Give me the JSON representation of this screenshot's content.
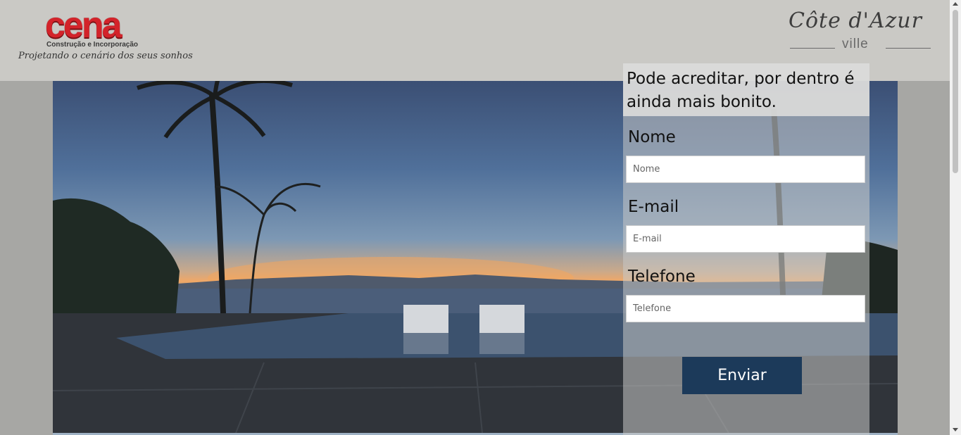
{
  "header": {
    "brand": {
      "name": "cena",
      "subtitle": "Construção e Incorporação",
      "tagline": "Projetando o cenário dos seus sonhos"
    },
    "project_logo": {
      "title": "Côte d'Azur",
      "subtitle": "ville"
    }
  },
  "form": {
    "heading": "Pode acreditar, por dentro é ainda mais bonito.",
    "fields": [
      {
        "label": "Nome",
        "placeholder": "Nome"
      },
      {
        "label": "E-mail",
        "placeholder": "E-mail"
      },
      {
        "label": "Telefone",
        "placeholder": "Telefone"
      }
    ],
    "submit_label": "Enviar"
  },
  "colors": {
    "header_bg": "#cac9c5",
    "brand_red": "#d3232a",
    "button_bg": "#1c3a5a"
  }
}
